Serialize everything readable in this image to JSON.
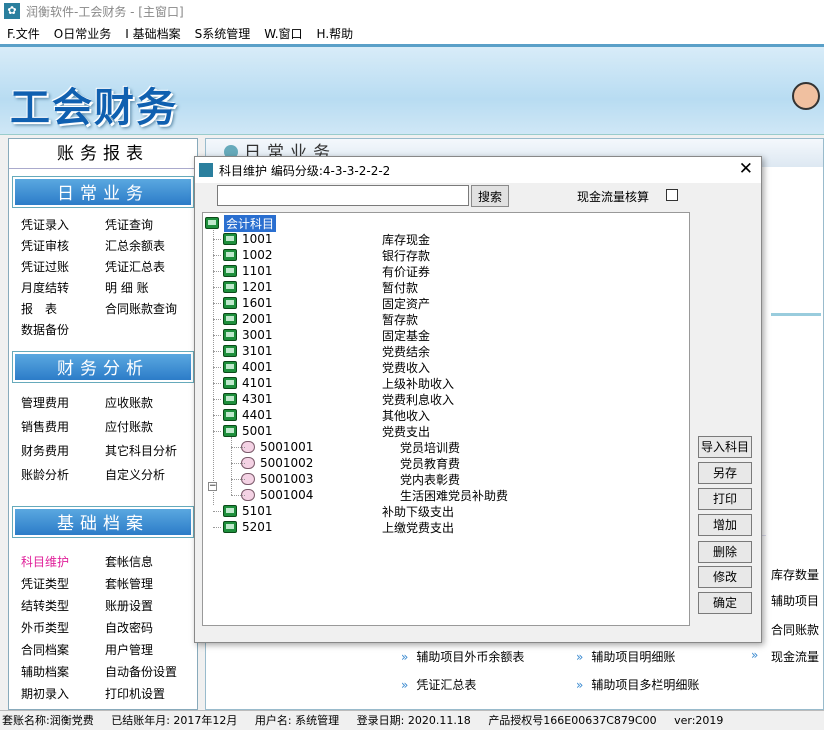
{
  "window": {
    "title": "润衡软件-工会财务 - [主窗口]"
  },
  "menu": [
    "F.文件",
    "O日常业务",
    "I 基础档案",
    "S系统管理",
    "W.窗口",
    "H.帮助"
  ],
  "banner": {
    "logo": "工会财务"
  },
  "left_panel": {
    "header": "账务报表",
    "daily": {
      "title": "日常业务",
      "items": [
        "凭证录入",
        "凭证查询",
        "凭证审核",
        "汇总余额表",
        "凭证过账",
        "凭证汇总表",
        "月度结转",
        "明 细 账",
        "报　表",
        "合同账款查询",
        "数据备份"
      ]
    },
    "analysis": {
      "title": "财务分析",
      "items": [
        "管理费用",
        "应收账款",
        "销售费用",
        "应付账款",
        "财务费用",
        "其它科目分析",
        "账龄分析",
        "自定义分析"
      ]
    },
    "archive": {
      "title": "基础档案",
      "items": [
        "科目维护",
        "套帐信息",
        "凭证类型",
        "套帐管理",
        "结转类型",
        "账册设置",
        "外币类型",
        "自改密码",
        "合同档案",
        "用户管理",
        "辅助档案",
        "自动备份设置",
        "期初录入",
        "打印机设置"
      ]
    }
  },
  "main_panel": {
    "header": "日常业务",
    "right_labels": [
      "库存数量",
      "辅助项目",
      "合同账款",
      "现金流量"
    ],
    "links": [
      "辅助项目外币余额表",
      "辅助项目明细账",
      "凭证汇总表",
      "辅助项目多栏明细账"
    ]
  },
  "dialog": {
    "title": "科目维护  编码分级:4-3-3-2-2-2",
    "search_value": "",
    "search_button": "搜索",
    "cash_flow_label": "现金流量核算",
    "cash_flow_checked": false,
    "tree_root": "会计科目",
    "accounts": [
      {
        "code": "1001",
        "name": "库存现金"
      },
      {
        "code": "1002",
        "name": "银行存款"
      },
      {
        "code": "1101",
        "name": "有价证券"
      },
      {
        "code": "1201",
        "name": "暂付款"
      },
      {
        "code": "1601",
        "name": "固定资产"
      },
      {
        "code": "2001",
        "name": "暂存款"
      },
      {
        "code": "3001",
        "name": "固定基金"
      },
      {
        "code": "3101",
        "name": "党费结余"
      },
      {
        "code": "4001",
        "name": "党费收入"
      },
      {
        "code": "4101",
        "name": "上级补助收入"
      },
      {
        "code": "4301",
        "name": "党费利息收入"
      },
      {
        "code": "4401",
        "name": "其他收入"
      },
      {
        "code": "5001",
        "name": "党费支出"
      }
    ],
    "sub_accounts": [
      {
        "code": "5001001",
        "name": "党员培训费"
      },
      {
        "code": "5001002",
        "name": "党员教育费"
      },
      {
        "code": "5001003",
        "name": "党内表彰费"
      },
      {
        "code": "5001004",
        "name": "生活困难党员补助费"
      }
    ],
    "accounts_after": [
      {
        "code": "5101",
        "name": "补助下级支出"
      },
      {
        "code": "5201",
        "name": "上缴党费支出"
      }
    ],
    "buttons": [
      "导入科目",
      "另存",
      "打印",
      "增加",
      "删除",
      "修改",
      "确定"
    ],
    "close_symbol": "✕"
  },
  "status": {
    "account": "套账名称:润衡党费",
    "closed": "已结账年月: 2017年12月",
    "user": "用户名: 系统管理",
    "login": "登录日期: 2020.11.18",
    "license": "产品授权号166E00637C879C00",
    "version": "ver:2019"
  },
  "colors": {
    "accent": "#2c7cc8",
    "active_item": "#e0209a",
    "selection": "#2a6fd0"
  }
}
